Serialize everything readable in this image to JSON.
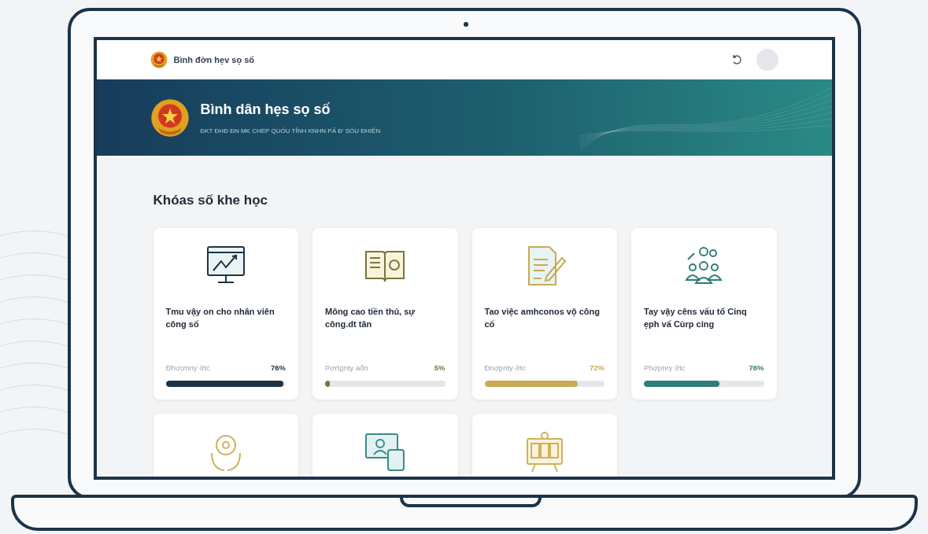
{
  "topbar": {
    "title": "Bình đờn hẹv sọ số"
  },
  "banner": {
    "title": "Bình dân hẹs sọ số",
    "subtitle": "ĐKT ĐHĐ ĐN MK CHẾP QUỐU TỈNH KNHN PẤ Đ' SỐU ĐHIỆN"
  },
  "section": {
    "title": "Khóas số khe học"
  },
  "courses": [
    {
      "title": "Tmu vậy on cho nhân viên công số",
      "progress_label": "Đhượnny ớtc",
      "percent": "76%",
      "level": 0.98,
      "color": "#1d3347"
    },
    {
      "title": "Mông cao tiền thủ, sự công.dt tân",
      "progress_label": "Pơrtgnty aốn",
      "percent": "5%",
      "level": 0.04,
      "color": "#7a7440"
    },
    {
      "title": "Tao việc amhconos vộ công cố",
      "progress_label": "Đnợpnty ớtc",
      "percent": "72%",
      "level": 0.78,
      "color": "#c9ab52"
    },
    {
      "title": "Tay vậy cêns vấu tổ Cinq ẹph vấ Cùrp cỉng",
      "progress_label": "Phợpnry ớtc",
      "percent": "76%",
      "level": 0.63,
      "color": "#2f7c78"
    },
    {
      "color": "#d1b15c"
    },
    {
      "color": "#3a8b8b"
    },
    {
      "color": "#d1b15c"
    }
  ]
}
